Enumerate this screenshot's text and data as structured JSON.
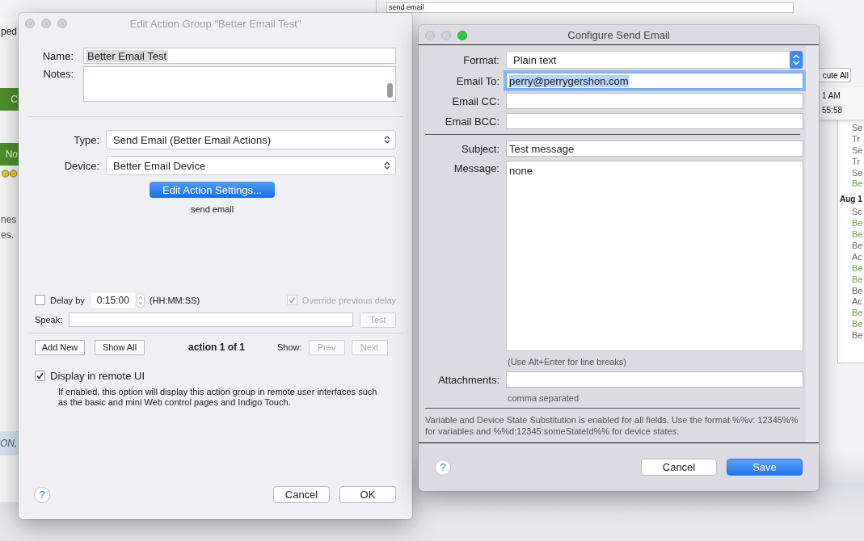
{
  "back_left": {
    "top_text": "ped",
    "green_buttons": [
      "C",
      "No"
    ],
    "lines": [
      "nes",
      "es."
    ],
    "bottom_text": "ON,"
  },
  "back_right": {
    "field": "send email",
    "button": "cute All",
    "times": [
      "1 AM",
      "55:58"
    ],
    "log": [
      {
        "kind": "entry",
        "text": "Se",
        "color": "#666666"
      },
      {
        "kind": "entry",
        "text": "Tr",
        "color": "#666666"
      },
      {
        "kind": "entry",
        "text": "Se",
        "color": "#666666"
      },
      {
        "kind": "entry",
        "text": "Tr",
        "color": "#666666"
      },
      {
        "kind": "entry",
        "text": "Se",
        "color": "#666666"
      },
      {
        "kind": "entry",
        "text": "Be",
        "color": "#6f9a4e"
      },
      {
        "kind": "date",
        "text": "Aug 1"
      },
      {
        "kind": "entry",
        "text": "Sc",
        "color": "#666666"
      },
      {
        "kind": "entry",
        "text": "Be",
        "color": "#6f9a4e"
      },
      {
        "kind": "entry",
        "text": "Be",
        "color": "#6f9a4e"
      },
      {
        "kind": "entry",
        "text": "Be",
        "color": "#666666"
      },
      {
        "kind": "entry",
        "text": "Ac",
        "color": "#666666"
      },
      {
        "kind": "entry",
        "text": "Be",
        "color": "#6f9a4e"
      },
      {
        "kind": "entry",
        "text": "Be",
        "color": "#6f9a4e"
      },
      {
        "kind": "entry",
        "text": "Be",
        "color": "#666666"
      },
      {
        "kind": "entry",
        "text": "Ac",
        "color": "#666666"
      },
      {
        "kind": "entry",
        "text": "Be",
        "color": "#6f9a4e"
      },
      {
        "kind": "entry",
        "text": "Be",
        "color": "#6f9a4e"
      },
      {
        "kind": "entry",
        "text": "Be",
        "color": "#666666"
      }
    ]
  },
  "edit_dialog": {
    "title": "Edit Action Group \"Better Email Test\"",
    "name": {
      "label": "Name:",
      "value": "Better Email Test",
      "highlighted": true
    },
    "notes": {
      "label": "Notes:"
    },
    "type": {
      "label": "Type:",
      "value": "Send Email (Better Email Actions)"
    },
    "device": {
      "label": "Device:",
      "value": "Better Email Device"
    },
    "edit_settings_button": "Edit Action Settings...",
    "action_name": "send email",
    "delay": {
      "label": "Delay by",
      "checked": false,
      "value": "0:15:00",
      "unit": "(HH:MM:SS)"
    },
    "override": {
      "label": "Override previous delay",
      "checked": true,
      "disabled": true
    },
    "speak": {
      "label": "Speak:",
      "button": {
        "label": "Test",
        "disabled": true
      }
    },
    "nav_buttons": [
      {
        "label": "Add New",
        "disabled": false
      },
      {
        "label": "Show All",
        "disabled": false
      }
    ],
    "counter": "action 1 of 1",
    "show_label": "Show:",
    "show_buttons": [
      {
        "label": "Prev",
        "disabled": true
      },
      {
        "label": "Next",
        "disabled": true
      }
    ],
    "remote": {
      "label": "Display in remote UI",
      "checked": true,
      "description": "If enabled, this option will display this action group in remote user interfaces such as the basic and mini Web control pages and Indigo Touch."
    },
    "help": "?",
    "buttons": [
      {
        "label": "Cancel",
        "primary": false
      },
      {
        "label": "OK",
        "primary": false
      }
    ]
  },
  "email_dialog": {
    "title": "Configure Send Email",
    "fields": [
      {
        "kind": "select",
        "label": "Format:",
        "value": "Plain text"
      },
      {
        "kind": "text",
        "label": "Email To:",
        "value": "perry@perrygershon.com",
        "focused": true
      },
      {
        "kind": "text",
        "label": "Email CC:",
        "focused": false
      },
      {
        "kind": "text",
        "label": "Email BCC:",
        "focused": false
      },
      {
        "kind": "divider"
      },
      {
        "kind": "text",
        "label": "Subject:",
        "value": "Test message",
        "focused": false
      },
      {
        "kind": "textarea",
        "label": "Message:",
        "value": "none",
        "hint": "(Use Alt+Enter for line breaks)"
      },
      {
        "kind": "text",
        "label": "Attachments:",
        "focused": false,
        "hint": "comma separated"
      }
    ],
    "note": "Variable and Device State Substitution is enabled for all fields. Use the format %%v: 12345%% for variables and %%d:12345:someStateId%% for device states.",
    "help": "?",
    "buttons": [
      {
        "label": "Cancel",
        "primary": false
      },
      {
        "label": "Save",
        "primary": true
      }
    ]
  }
}
